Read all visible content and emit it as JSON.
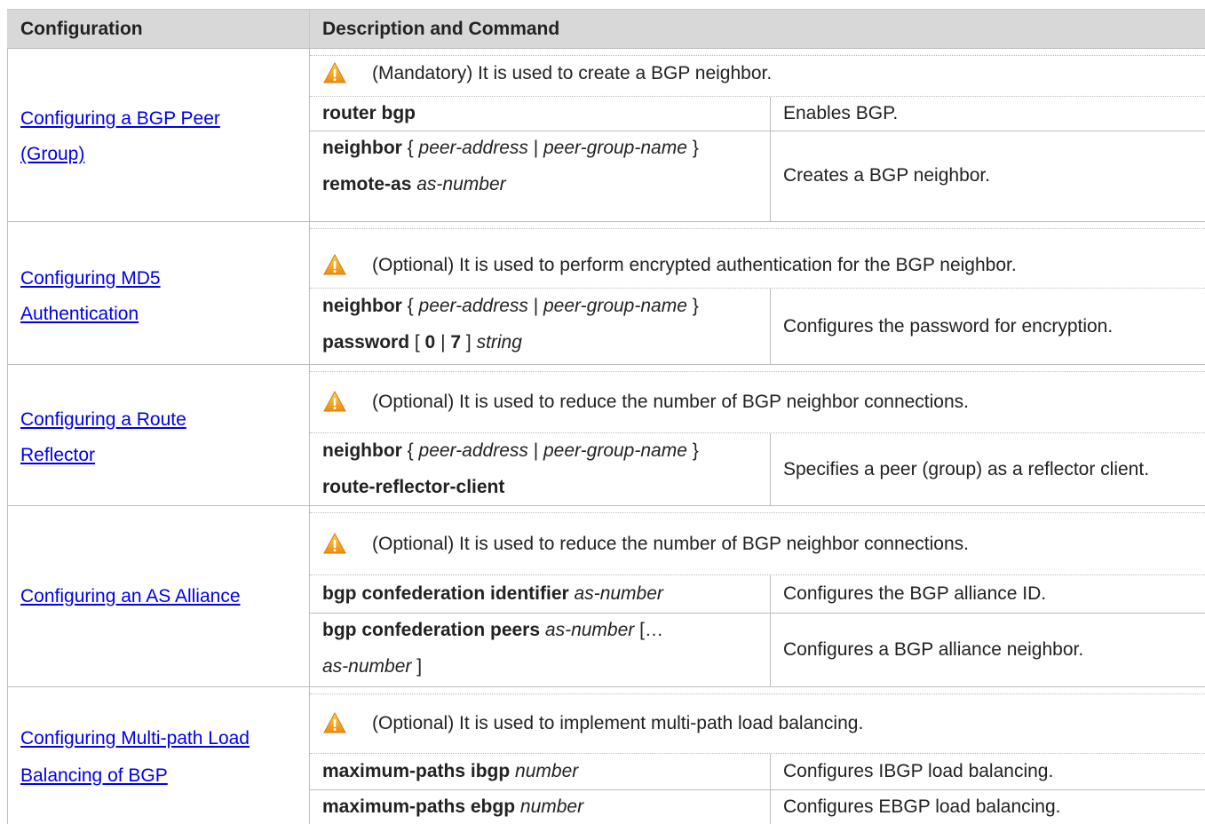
{
  "header": {
    "col1": "Configuration",
    "col2": "Description and Command"
  },
  "rows": [
    {
      "link_lines": [
        "Configuring a BGP Peer ",
        "(Group)"
      ],
      "note": "(Mandatory) It is used to create a BGP neighbor.",
      "commands": [
        {
          "cmd": [
            {
              "t": "router bgp",
              "s": "b"
            }
          ],
          "desc": "Enables BGP."
        },
        {
          "cmd": [
            {
              "t": "neighbor",
              "s": "b"
            },
            {
              "t": " { ",
              "s": ""
            },
            {
              "t": "peer-address",
              "s": "i"
            },
            {
              "t": " | ",
              "s": ""
            },
            {
              "t": "peer-group-name",
              "s": "i"
            },
            {
              "t": " }",
              "s": ""
            }
          ],
          "cmd2": [
            {
              "t": "remote-as",
              "s": "b"
            },
            {
              "t": " ",
              "s": ""
            },
            {
              "t": "as-number",
              "s": "i"
            }
          ],
          "desc": "Creates a BGP neighbor."
        }
      ]
    },
    {
      "link_lines": [
        "Configuring MD5 ",
        "Authentication"
      ],
      "note": "(Optional) It is used to perform encrypted authentication for the BGP neighbor.",
      "commands": [
        {
          "cmd": [
            {
              "t": "neighbor",
              "s": "b"
            },
            {
              "t": " { ",
              "s": ""
            },
            {
              "t": "peer-address",
              "s": "i"
            },
            {
              "t": " | ",
              "s": ""
            },
            {
              "t": "peer-group-name",
              "s": "i"
            },
            {
              "t": " }",
              "s": ""
            }
          ],
          "cmd2": [
            {
              "t": "password",
              "s": "b"
            },
            {
              "t": " [ ",
              "s": ""
            },
            {
              "t": "0",
              "s": "b"
            },
            {
              "t": " | ",
              "s": ""
            },
            {
              "t": "7",
              "s": "b"
            },
            {
              "t": " ] ",
              "s": ""
            },
            {
              "t": "string",
              "s": "i"
            }
          ],
          "desc": "Configures the password for encryption."
        }
      ]
    },
    {
      "link_lines": [
        "Configuring a Route ",
        "Reflector"
      ],
      "note": "(Optional) It is used to reduce the number of BGP neighbor connections.",
      "commands": [
        {
          "cmd": [
            {
              "t": "neighbor",
              "s": "b"
            },
            {
              "t": " { ",
              "s": ""
            },
            {
              "t": "peer-address",
              "s": "i"
            },
            {
              "t": " | ",
              "s": ""
            },
            {
              "t": "peer-group-name",
              "s": "i"
            },
            {
              "t": " }",
              "s": ""
            }
          ],
          "cmd2": [
            {
              "t": "route-reflector-client",
              "s": "b"
            }
          ],
          "desc": "Specifies a peer (group) as a reflector client."
        }
      ]
    },
    {
      "link_lines": [
        "Configuring an AS Alliance"
      ],
      "note": "(Optional) It is used to reduce the number of BGP neighbor connections.",
      "commands": [
        {
          "cmd": [
            {
              "t": "bgp confederation identifier",
              "s": "b"
            },
            {
              "t": " ",
              "s": ""
            },
            {
              "t": "as-number",
              "s": "i"
            }
          ],
          "desc": "Configures the BGP alliance ID."
        },
        {
          "cmd": [
            {
              "t": "bgp confederation peers",
              "s": "b"
            },
            {
              "t": " ",
              "s": ""
            },
            {
              "t": "as-number",
              "s": "i"
            },
            {
              "t": " […",
              "s": ""
            }
          ],
          "cmd2": [
            {
              "t": "as-number",
              "s": "i"
            },
            {
              "t": " ]",
              "s": ""
            }
          ],
          "desc": "Configures a BGP alliance neighbor."
        }
      ]
    },
    {
      "link_lines": [
        "Configuring Multi-path Load ",
        "Balancing of BGP"
      ],
      "note": "(Optional) It is used to implement multi-path load balancing.",
      "commands": [
        {
          "cmd": [
            {
              "t": "maximum-paths ibgp",
              "s": "b"
            },
            {
              "t": " ",
              "s": ""
            },
            {
              "t": "number",
              "s": "i"
            }
          ],
          "desc": "Configures IBGP load balancing."
        },
        {
          "cmd": [
            {
              "t": "maximum-paths ebgp",
              "s": "b"
            },
            {
              "t": " ",
              "s": ""
            },
            {
              "t": "number",
              "s": "i"
            }
          ],
          "desc": "Configures EBGP load balancing."
        }
      ]
    }
  ],
  "icons": {
    "warning": "warning-icon",
    "warning_color": "#f39a1e"
  }
}
